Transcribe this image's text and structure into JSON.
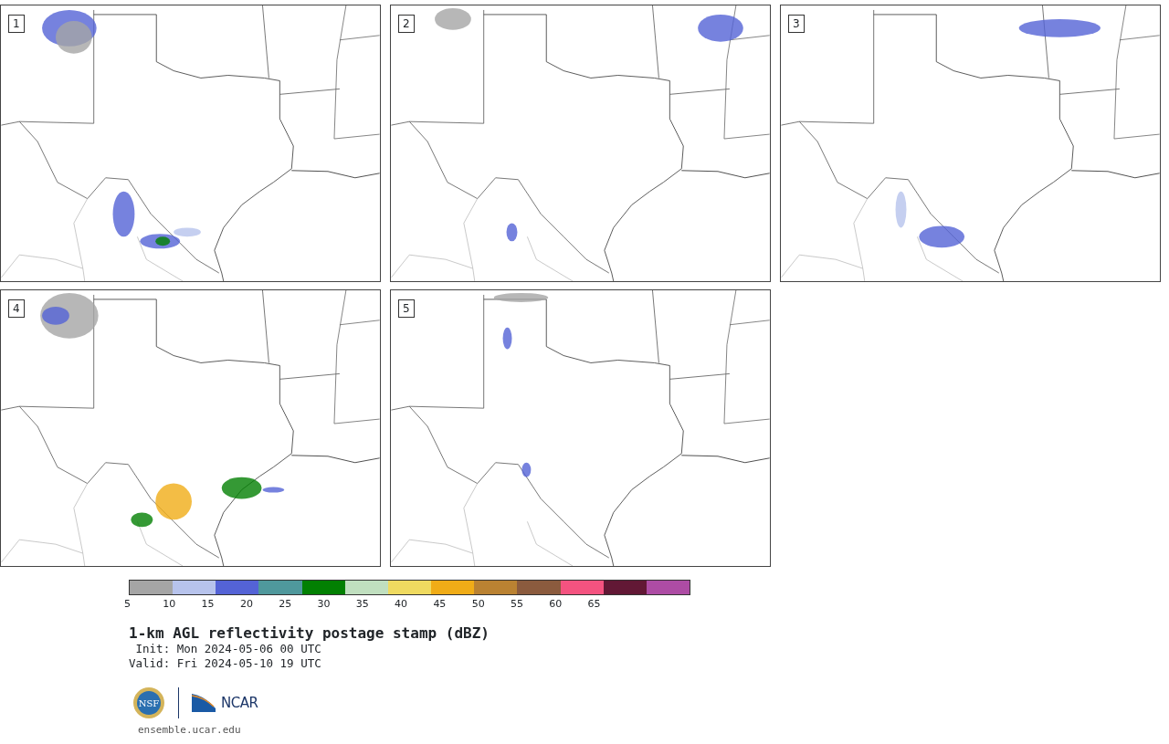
{
  "panels": [
    {
      "label": "1"
    },
    {
      "label": "2"
    },
    {
      "label": "3"
    },
    {
      "label": "4"
    },
    {
      "label": "5"
    }
  ],
  "colorbar": {
    "segments": [
      {
        "color": "#a5a5a5"
      },
      {
        "color": "#b7c3ec"
      },
      {
        "color": "#5463d6"
      },
      {
        "color": "#4f989c"
      },
      {
        "color": "#028002"
      },
      {
        "color": "#c0dfbf"
      },
      {
        "color": "#efda60"
      },
      {
        "color": "#f0ac17"
      },
      {
        "color": "#ba8232"
      },
      {
        "color": "#8b5b3e"
      },
      {
        "color": "#f45380"
      },
      {
        "color": "#621835"
      },
      {
        "color": "#ad4ca4"
      }
    ],
    "ticks": [
      "5",
      "10",
      "15",
      "20",
      "25",
      "30",
      "35",
      "40",
      "45",
      "50",
      "55",
      "60",
      "65"
    ]
  },
  "title": "1-km AGL reflectivity postage stamp (dBZ)",
  "init": " Init: Mon 2024-05-06 00 UTC",
  "valid": "Valid: Fri 2024-05-10 19 UTC",
  "logos": {
    "nsf": "NSF",
    "ncar": "NCAR"
  },
  "url": "ensemble.ucar.edu"
}
